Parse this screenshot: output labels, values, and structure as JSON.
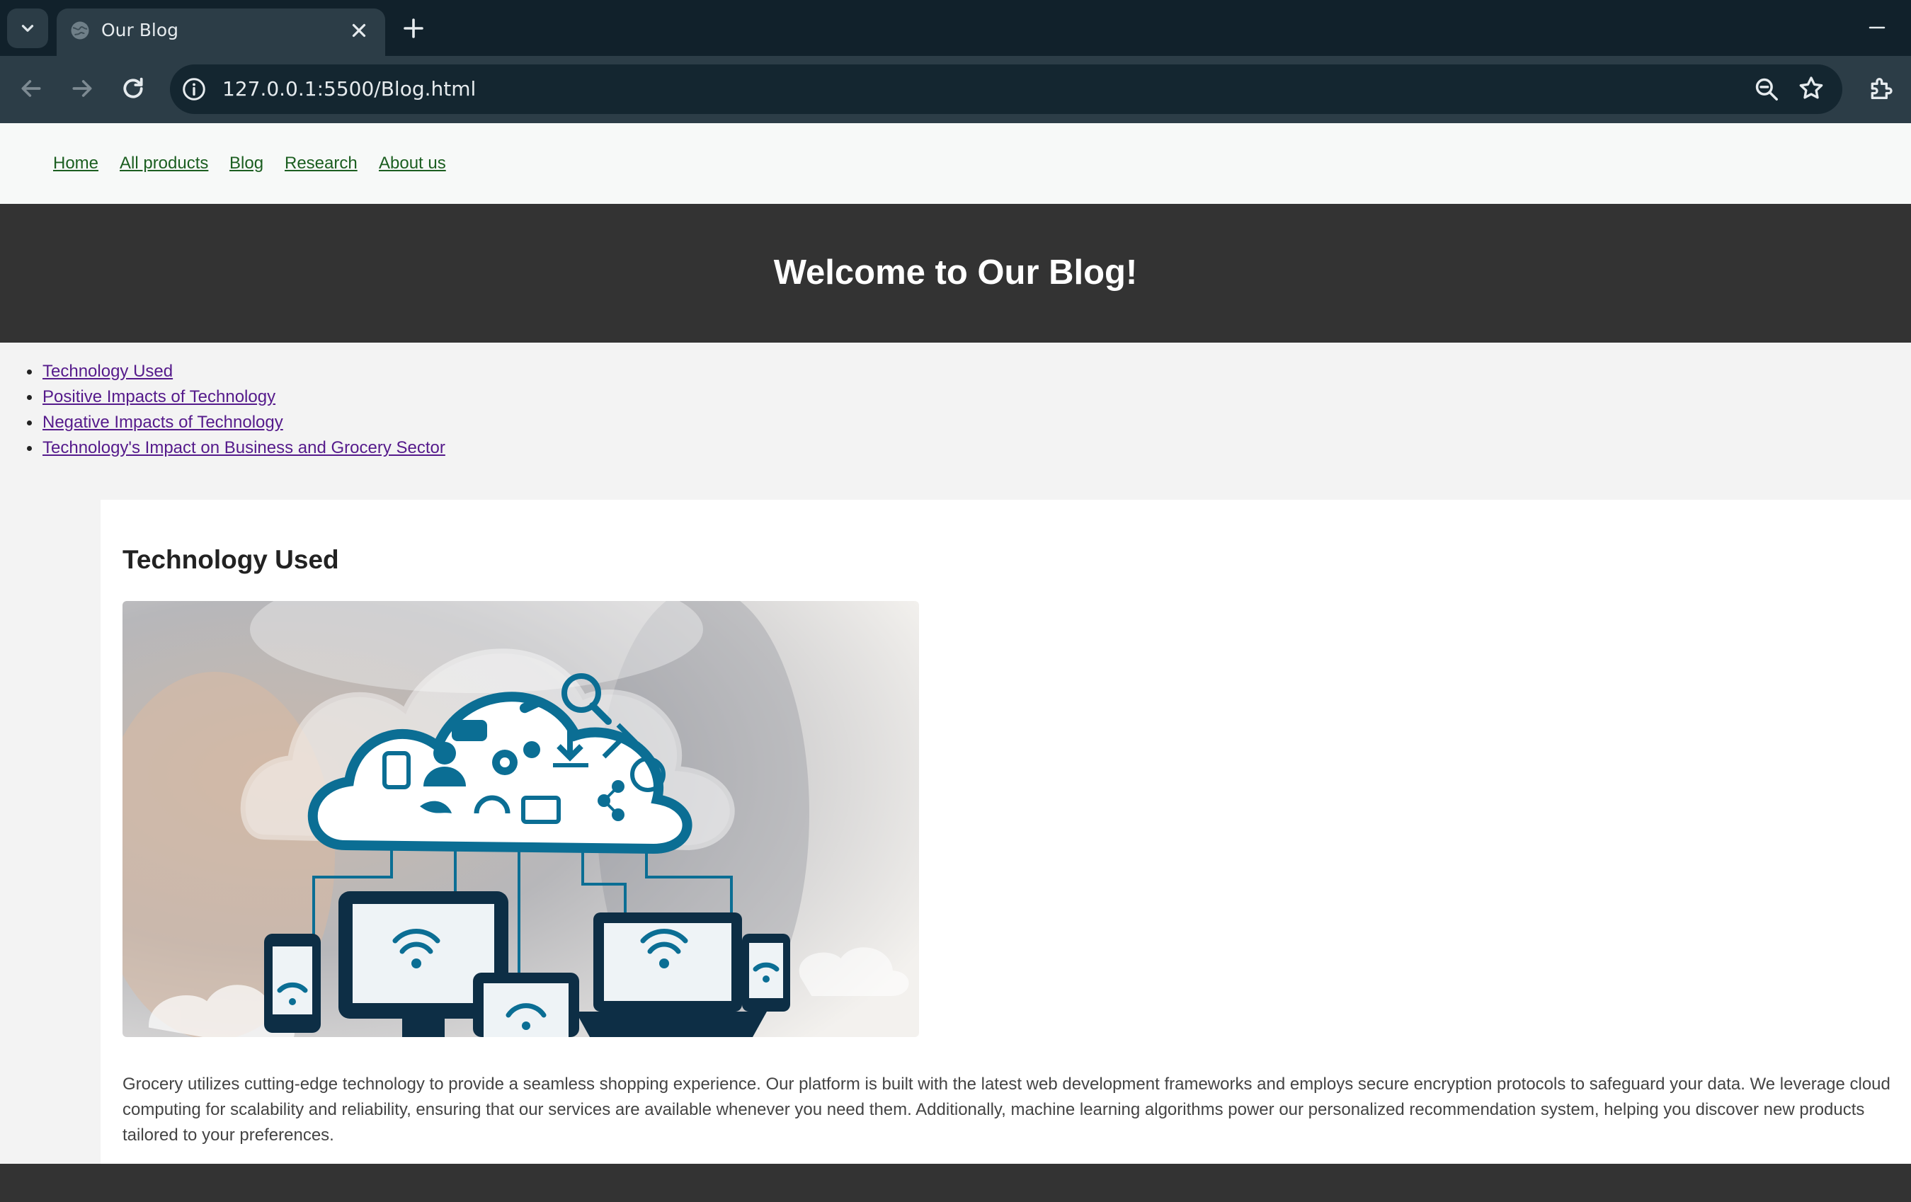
{
  "browser": {
    "tab_title": "Our Blog",
    "url": "127.0.0.1:5500/Blog.html",
    "icons": [
      "tab-list-icon",
      "globe-icon",
      "close-icon",
      "plus-icon",
      "minimize-icon",
      "back-icon",
      "forward-icon",
      "reload-icon",
      "site-info-icon",
      "zoom-icon",
      "star-icon",
      "extensions-icon"
    ]
  },
  "nav": {
    "links": [
      "Home",
      "All products",
      "Blog",
      "Research",
      "About us"
    ]
  },
  "hero": {
    "title": "Welcome to Our Blog!"
  },
  "toc": {
    "items": [
      "Technology Used",
      "Positive Impacts of Technology",
      "Negative Impacts of Technology",
      "Technology's Impact on Business and Grocery Sector"
    ]
  },
  "article": {
    "heading": "Technology Used",
    "image_subject": "cloud-computing-devices-illustration",
    "body": "Grocery utilizes cutting-edge technology to provide a seamless shopping experience. Our platform is built with the latest web development frameworks and employs secure encryption protocols to safeguard your data. We leverage cloud computing for scalability and reliability, ensuring that our services are available whenever you need them. Additionally, machine learning algorithms power our personalized recommendation system, helping you discover new products tailored to your preferences."
  },
  "colors": {
    "chrome_dark": "#11212b",
    "chrome_toolbar": "#2c3d47",
    "hero_bg": "#333333",
    "nav_link": "#1b5e20",
    "toc_link": "#551a8b",
    "illustration_blue": "#0b6e94",
    "illustration_navy": "#0d2e45"
  }
}
